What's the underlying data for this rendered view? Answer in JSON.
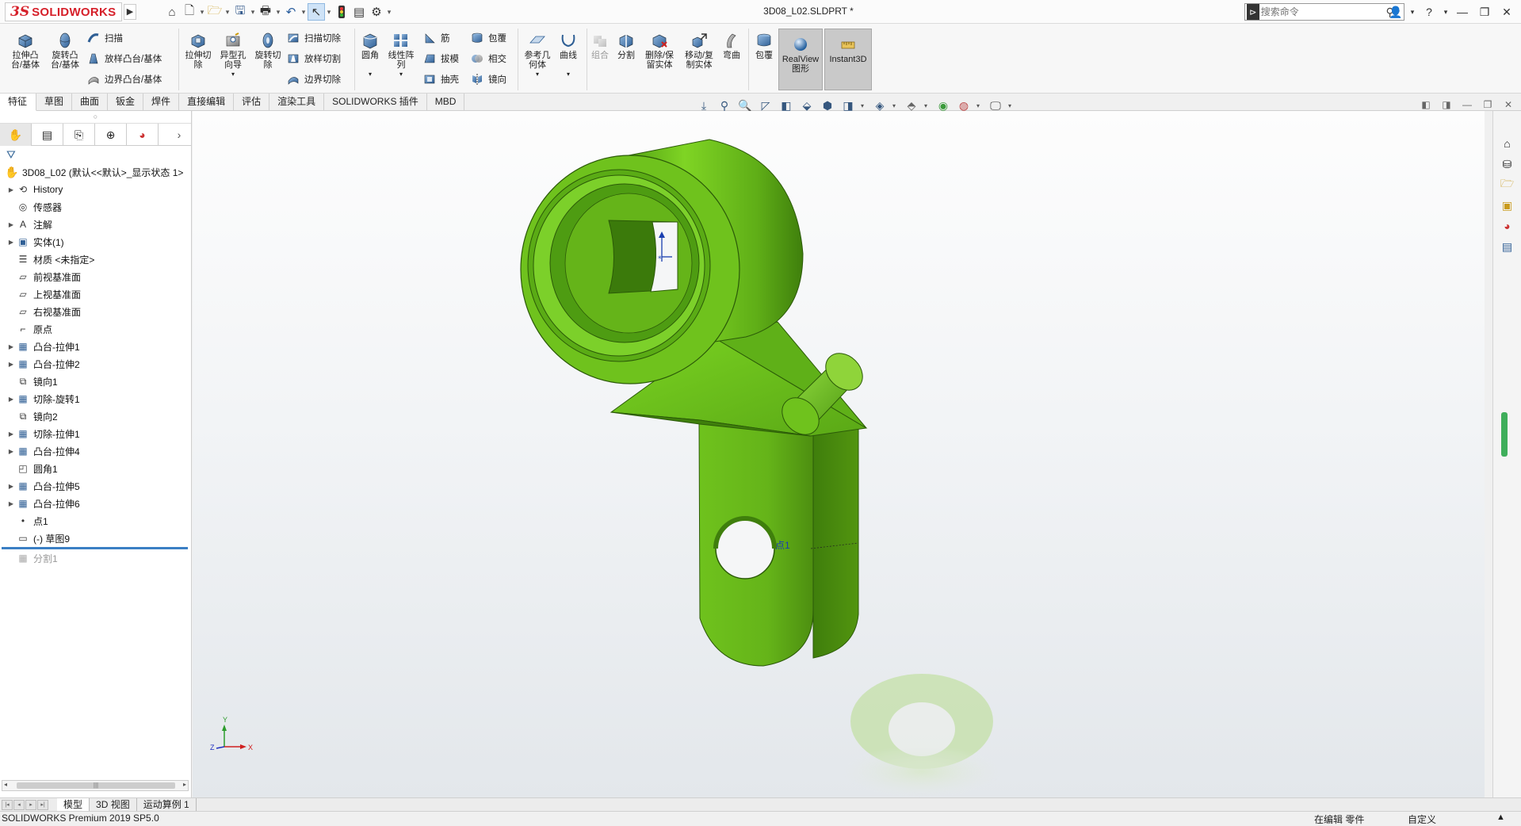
{
  "app": {
    "logo_ds": "3S",
    "logo_text": "SOLIDWORKS",
    "document_title": "3D08_L02.SLDPRT *",
    "search_placeholder": "搜索命令"
  },
  "ribbon": {
    "extrude_boss": "拉伸凸\n台/基体",
    "revolve_boss": "旋转凸\n台/基体",
    "sweep": "扫描",
    "loft_boss": "放样凸台/基体",
    "boundary_boss": "边界凸台/基体",
    "extrude_cut": "拉伸切\n除",
    "hole_wizard": "异型孔\n向导",
    "revolve_cut": "旋转切\n除",
    "swept_cut": "扫描切除",
    "lofted_cut": "放样切割",
    "boundary_cut": "边界切除",
    "fillet": "圆角",
    "linear_pattern": "线性阵\n列",
    "rib": "筋",
    "draft": "拔模",
    "shell": "抽壳",
    "wrap": "包覆",
    "intersect": "相交",
    "mirror": "镜向",
    "ref_geometry": "参考几\n何体",
    "curves": "曲线",
    "combine": "组合",
    "split": "分割",
    "delete_keep_body": "删除/保\n留实体",
    "move_copy_body": "移动/复\n制实体",
    "flex": "弯曲",
    "wrap2": "包覆",
    "realview": "RealView\n图形",
    "instant3d": "Instant3D"
  },
  "command_tabs": [
    "特征",
    "草图",
    "曲面",
    "钣金",
    "焊件",
    "直接编辑",
    "评估",
    "渲染工具",
    "SOLIDWORKS 插件",
    "MBD"
  ],
  "feature_tree": {
    "root": "3D08_L02  (默认<<默认>_显示状态 1>",
    "items": [
      {
        "label": "History",
        "expand": true,
        "icon": "history"
      },
      {
        "label": "传感器",
        "expand": false,
        "icon": "sensor"
      },
      {
        "label": "注解",
        "expand": true,
        "icon": "annotation"
      },
      {
        "label": "实体(1)",
        "expand": true,
        "icon": "solid"
      },
      {
        "label": "材质 <未指定>",
        "expand": false,
        "icon": "material"
      },
      {
        "label": "前视基准面",
        "expand": false,
        "icon": "plane"
      },
      {
        "label": "上视基准面",
        "expand": false,
        "icon": "plane"
      },
      {
        "label": "右视基准面",
        "expand": false,
        "icon": "plane"
      },
      {
        "label": "原点",
        "expand": false,
        "icon": "origin"
      },
      {
        "label": "凸台-拉伸1",
        "expand": true,
        "icon": "feature"
      },
      {
        "label": "凸台-拉伸2",
        "expand": true,
        "icon": "feature"
      },
      {
        "label": "镜向1",
        "expand": false,
        "icon": "mirror"
      },
      {
        "label": "切除-旋转1",
        "expand": true,
        "icon": "feature"
      },
      {
        "label": "镜向2",
        "expand": false,
        "icon": "mirror"
      },
      {
        "label": "切除-拉伸1",
        "expand": true,
        "icon": "feature"
      },
      {
        "label": "凸台-拉伸4",
        "expand": true,
        "icon": "feature"
      },
      {
        "label": "圆角1",
        "expand": false,
        "icon": "fillet"
      },
      {
        "label": "凸台-拉伸5",
        "expand": true,
        "icon": "feature"
      },
      {
        "label": "凸台-拉伸6",
        "expand": true,
        "icon": "feature"
      },
      {
        "label": "点1",
        "expand": false,
        "icon": "point"
      },
      {
        "label": "(-) 草图9",
        "expand": false,
        "icon": "sketch"
      }
    ],
    "suppressed_item": "分割1"
  },
  "viewport": {
    "point_label": "点1",
    "part_color": "#6cc11a",
    "axis_y": "Y",
    "axis_x": "X",
    "axis_z": "Z"
  },
  "bottom_tabs": [
    "模型",
    "3D 视图",
    "运动算例 1"
  ],
  "status": {
    "left": "SOLIDWORKS Premium 2019 SP5.0",
    "mid": "在编辑 零件",
    "right": "自定义",
    "right_arrow": "▲"
  }
}
